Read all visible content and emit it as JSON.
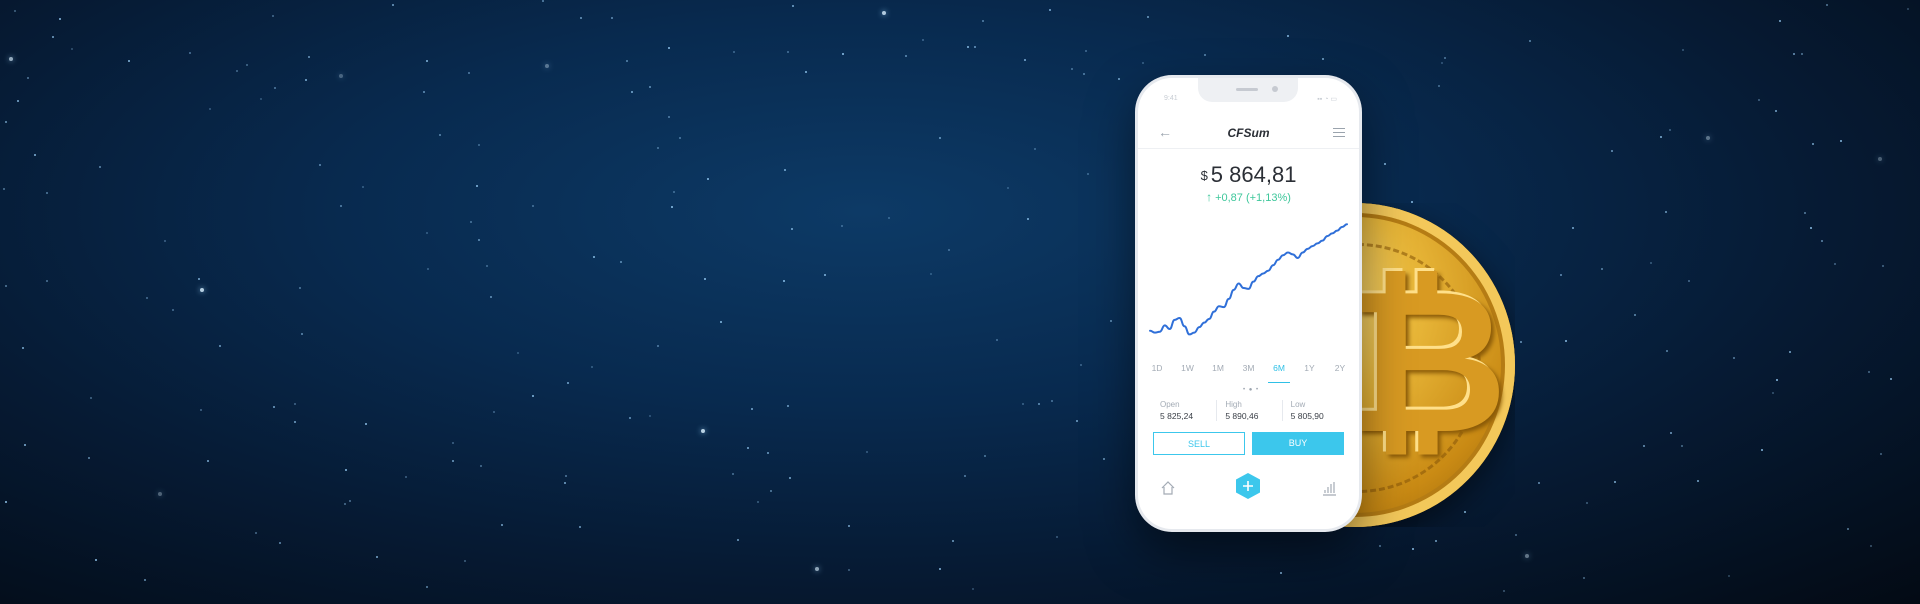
{
  "app": {
    "title": "CFSum",
    "status_time": "9:41",
    "status_icons": "▪▪ ◔ ▭"
  },
  "price": {
    "currency": "$",
    "value": "5 864,81",
    "change_arrow": "↑",
    "change": "+0,87 (+1,13%)"
  },
  "chart_data": {
    "type": "line",
    "x": [
      0,
      1,
      2,
      3,
      4,
      5,
      6,
      7,
      8,
      9,
      10,
      11,
      12,
      13,
      14,
      15,
      16,
      17,
      18,
      19,
      20,
      21,
      22,
      23,
      24,
      25,
      26,
      27,
      28,
      29,
      30,
      31,
      32,
      33,
      34,
      35,
      36,
      37,
      38,
      39,
      40
    ],
    "values": [
      20,
      18,
      19,
      26,
      22,
      32,
      34,
      25,
      16,
      18,
      24,
      29,
      33,
      41,
      47,
      46,
      55,
      65,
      72,
      67,
      66,
      74,
      80,
      83,
      86,
      92,
      98,
      103,
      106,
      104,
      100,
      106,
      110,
      113,
      116,
      119,
      124,
      127,
      130,
      134,
      137
    ],
    "color": "#2f6fd8",
    "grid": false
  },
  "ranges": {
    "items": [
      "1D",
      "1W",
      "1M",
      "3M",
      "6M",
      "1Y",
      "2Y"
    ],
    "active": "6M"
  },
  "stats": [
    {
      "label": "Open",
      "value": "5 825,24"
    },
    {
      "label": "High",
      "value": "5 890,46"
    },
    {
      "label": "Low",
      "value": "5 805,90"
    }
  ],
  "actions": {
    "sell": "SELL",
    "buy": "BUY"
  },
  "colors": {
    "accent": "#3cc7ec",
    "positive": "#3ec79b",
    "gold": "#e0a93a"
  }
}
